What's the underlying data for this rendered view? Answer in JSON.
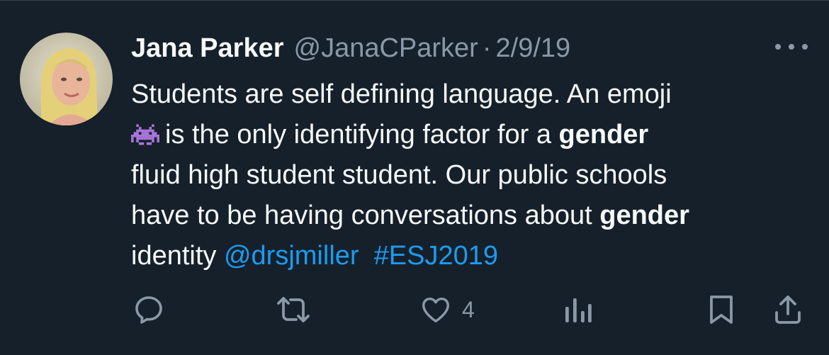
{
  "tweet": {
    "author_name": "Jana Parker",
    "handle": "@JanaCParker",
    "separator": "·",
    "date": "2/9/19",
    "lines": [
      {
        "pre": "Students are self defining language. An emoji"
      },
      {
        "emoji": "alien-monster-emoji",
        "pre": "is the only identifying factor for a ",
        "bold": "gender"
      },
      {
        "pre": "fluid high student student. Our public schools"
      },
      {
        "pre": "have to be having conversations about ",
        "bold": "gender"
      },
      {
        "pre": "identity ",
        "mention": "@drsjmiller",
        "hashtag": "#ESJ2019"
      }
    ]
  },
  "actions": {
    "reply_icon": "reply-icon",
    "retweet_icon": "retweet-icon",
    "like_icon": "heart-icon",
    "like_count": "4",
    "views_icon": "analytics-icon",
    "bookmark_icon": "bookmark-icon",
    "share_icon": "share-icon"
  },
  "colors": {
    "background": "#15202b",
    "text": "#f7f9f9",
    "muted": "#8b98a5",
    "link": "#1d9bf0",
    "emoji": "#a875d8"
  }
}
